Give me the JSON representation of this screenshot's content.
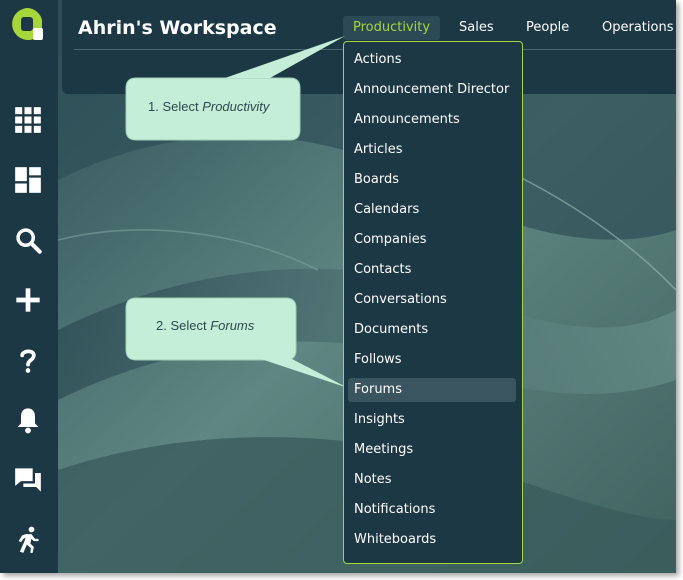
{
  "header": {
    "workspace_title": "Ahrin's Workspace",
    "tabs": [
      {
        "label": "Productivity",
        "active": true
      },
      {
        "label": "Sales"
      },
      {
        "label": "People"
      },
      {
        "label": "Operations"
      }
    ]
  },
  "sidebar": {
    "icons": [
      "apps-grid-icon",
      "dashboard-icon",
      "search-icon",
      "plus-icon",
      "help-icon",
      "bell-icon",
      "chat-icon",
      "runner-icon"
    ]
  },
  "dropdown": {
    "items": [
      "Actions",
      "Announcement Director",
      "Announcements",
      "Articles",
      "Boards",
      "Calendars",
      "Companies",
      "Contacts",
      "Conversations",
      "Documents",
      "Follows",
      "Forums",
      "Insights",
      "Meetings",
      "Notes",
      "Notifications",
      "Whiteboards"
    ],
    "highlighted": "Forums"
  },
  "callouts": {
    "step1": {
      "prefix": "1. Select ",
      "emph": "Productivity"
    },
    "step2": {
      "prefix": "2. Select ",
      "emph": "Forums"
    }
  },
  "colors": {
    "accent": "#a6d63a",
    "navy": "#1d3845",
    "callout_fill": "#c4eed8"
  }
}
